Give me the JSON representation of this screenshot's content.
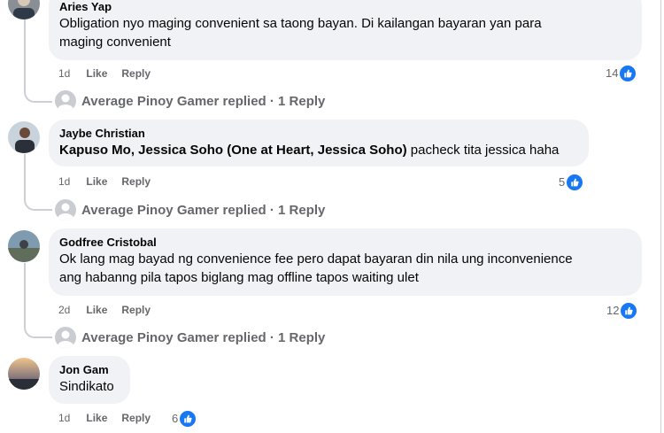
{
  "comments": [
    {
      "name": "Aries Yap",
      "text_lines": [
        "Obligation nyo maging convenient sa taong bayan. Di kailangan bayaran yan para",
        "maging convenient"
      ],
      "time": "1d",
      "like": "Like",
      "reply": "Reply",
      "reactions": "14",
      "replies": "Average Pinoy Gamer replied · 1 Reply"
    },
    {
      "name": "Jaybe Christian",
      "tag": "Kapuso Mo, Jessica Soho (One at Heart, Jessica Soho)",
      "text": " pacheck tita jessica haha",
      "time": "1d",
      "like": "Like",
      "reply": "Reply",
      "reactions": "5",
      "replies": "Average Pinoy Gamer replied · 1 Reply"
    },
    {
      "name": "Godfree Cristobal",
      "text_lines": [
        "Ok lang mag bayad ng convenience fee pero dapat bayaran din nila ung inconvenience",
        "ang habanng pila tapos biglang mag offline tapos waiting ulet"
      ],
      "time": "2d",
      "like": "Like",
      "reply": "Reply",
      "reactions": "12",
      "replies": "Average Pinoy Gamer replied · 1 Reply"
    },
    {
      "name": "Jon Gam",
      "text": "Sindikato",
      "time": "1d",
      "like": "Like",
      "reply": "Reply",
      "reactions": "6"
    }
  ],
  "colors": {
    "like_blue": "#1877f2",
    "bubble": "#f0f2f5",
    "meta": "#65676b"
  },
  "icons": [
    "thumbs-up-icon",
    "user-avatar",
    "default-avatar-icon"
  ]
}
